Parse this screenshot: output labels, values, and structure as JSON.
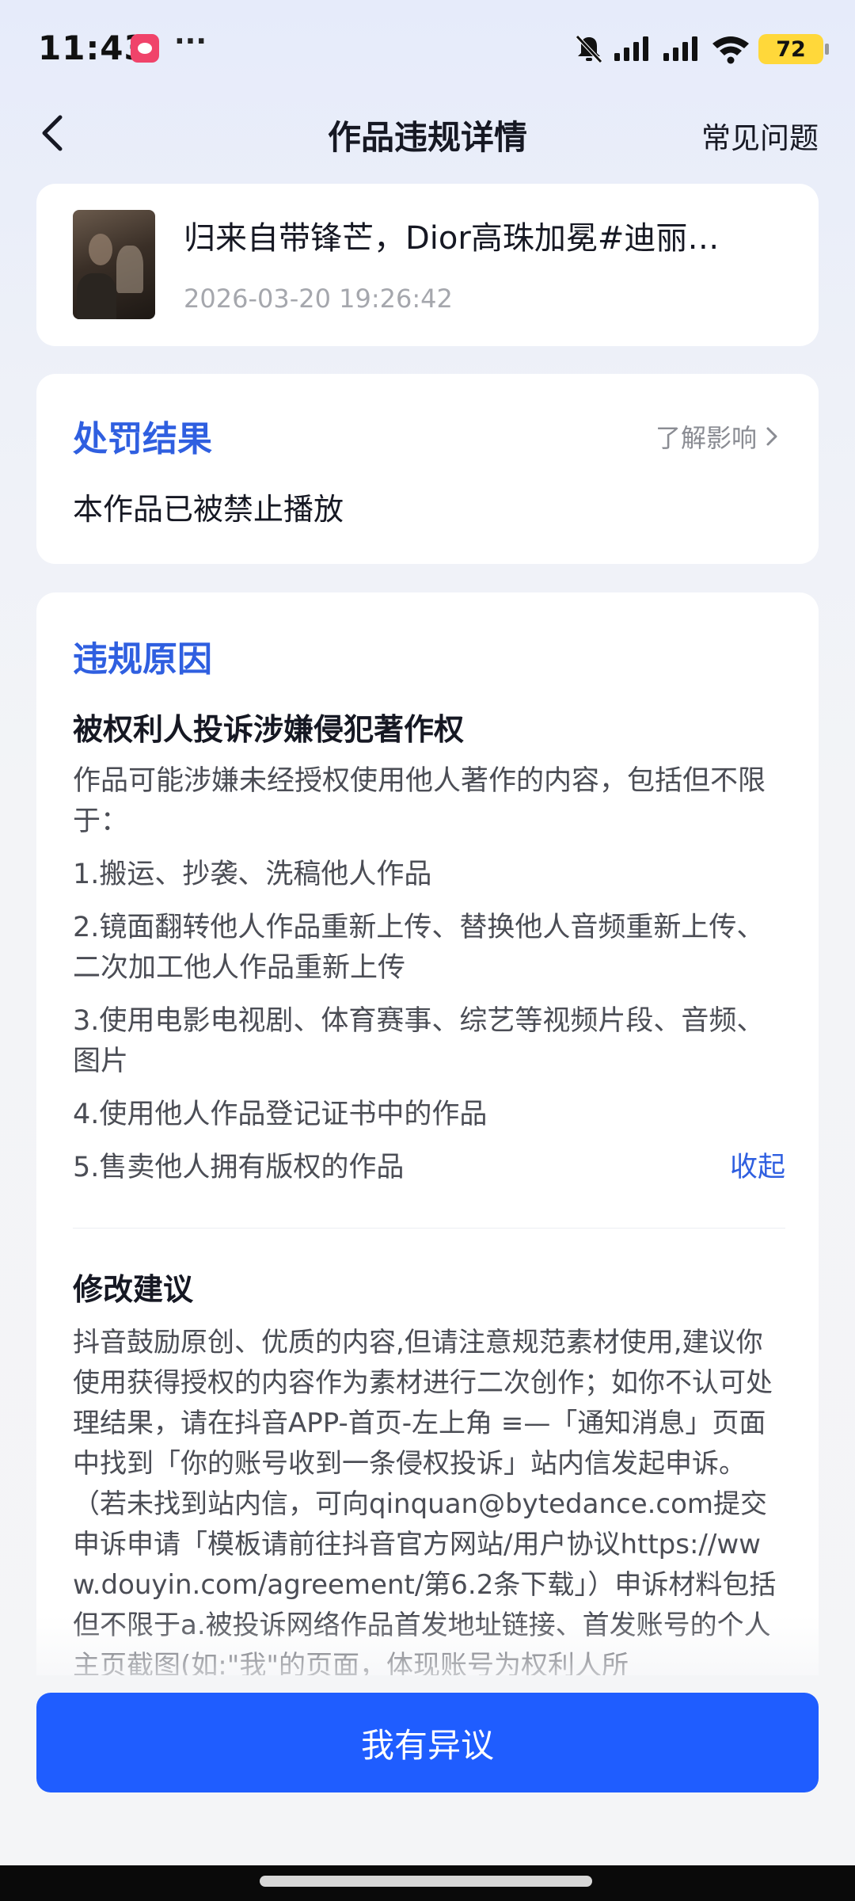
{
  "status_bar": {
    "time": "11:43",
    "dots": "···",
    "battery": "72",
    "icons": [
      "app-notification-icon",
      "mute-bell-icon",
      "signal-icon",
      "signal-icon",
      "wifi-icon",
      "battery-icon"
    ]
  },
  "header": {
    "title": "作品违规详情",
    "faq": "常见问题",
    "back_icon": "chevron-left-icon"
  },
  "video": {
    "title": "归来自带锋芒，Dior高珠加冕#迪丽…",
    "time": "2026-03-20 19:26:42"
  },
  "punishment": {
    "title": "处罚结果",
    "learn_more": "了解影响",
    "result": "本作品已被禁止播放"
  },
  "reason": {
    "title": "违规原因",
    "type": "被权利人投诉涉嫌侵犯著作权",
    "description": "作品可能涉嫌未经授权使用他人著作的内容，包括但不限于：",
    "items": [
      "1.搬运、抄袭、洗稿他人作品",
      "2.镜面翻转他人作品重新上传、替换他人音频重新上传、二次加工他人作品重新上传",
      "3.使用电影电视剧、体育赛事、综艺等视频片段、音频、图片",
      "4.使用他人作品登记证书中的作品",
      "5.售卖他人拥有版权的作品"
    ],
    "collapse": "收起"
  },
  "suggestion": {
    "title": "修改建议",
    "text": "抖音鼓励原创、优质的内容,但请注意规范素材使用,建议你使用获得授权的内容作为素材进行二次创作；如你不认可处理结果，请在抖音APP-首页-左上角 ≡—「通知消息」页面中找到「你的账号收到一条侵权投诉」站内信发起申诉。（若未找到站内信，可向qinquan@bytedance.com提交申诉申请「模板请前往抖音官方网站/用户协议https://www.douyin.com/agreement/第6.2条下载」）申诉材料包括但不限于a.被投诉网络作品首发地址链接、首发账号的个人主页截图(如:\"我\"的页面，体现账号为权利人所"
  },
  "actions": {
    "objection": "我有异议"
  },
  "colors": {
    "accent": "#2f5fe0",
    "button": "#1f5dff",
    "battery": "#ffd83a",
    "app_icon": "#f0436a"
  }
}
